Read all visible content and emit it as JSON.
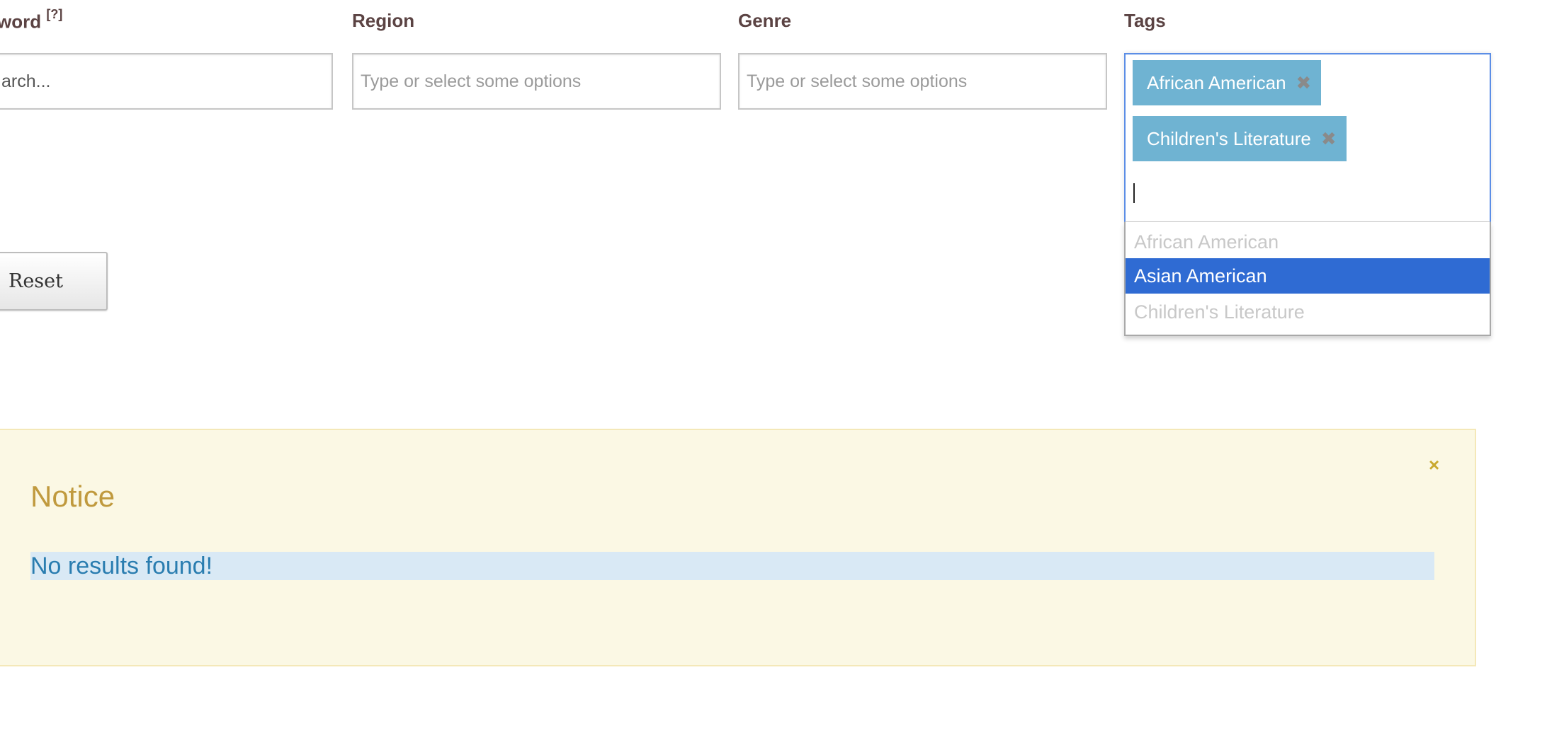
{
  "filters": {
    "keyword": {
      "label": "word",
      "help": "[?]",
      "value": "arch..."
    },
    "region": {
      "label": "Region",
      "placeholder": "Type or select some options"
    },
    "genre": {
      "label": "Genre",
      "placeholder": "Type or select some options"
    },
    "tags": {
      "label": "Tags",
      "selected": [
        {
          "label": "African American",
          "remove": "✖"
        },
        {
          "label": "Children's Literature",
          "remove": "✖"
        }
      ],
      "options": [
        {
          "label": "African American",
          "state": "disabled"
        },
        {
          "label": "Asian American",
          "state": "highlighted"
        },
        {
          "label": "Children's Literature",
          "state": "disabled"
        }
      ]
    }
  },
  "actions": {
    "reset_label": "Reset"
  },
  "notice": {
    "title": "Notice",
    "close": "×",
    "message": "No results found!"
  },
  "colors": {
    "label": "#5b4343",
    "chip": "#6fb3d2",
    "highlight": "#2f6bd3",
    "notice_bg": "#fbf8e4",
    "notice_title": "#c09a3e",
    "message_bg": "#d9e9f5",
    "message_text": "#2a7db0"
  }
}
